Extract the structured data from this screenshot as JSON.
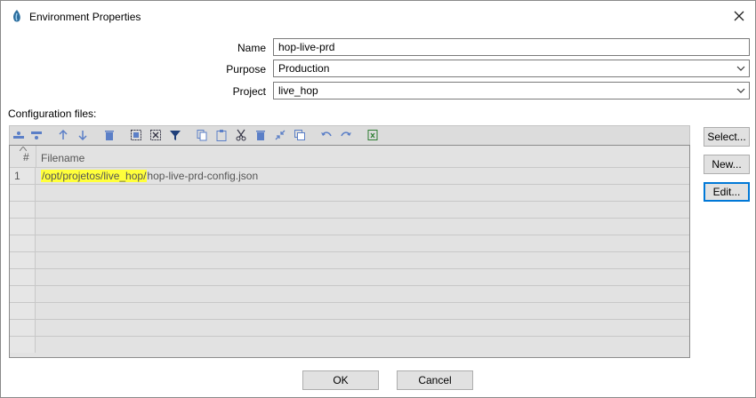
{
  "window": {
    "title": "Environment Properties"
  },
  "form": {
    "name_label": "Name",
    "name_value": "hop-live-prd",
    "purpose_label": "Purpose",
    "purpose_value": "Production",
    "project_label": "Project",
    "project_value": "live_hop"
  },
  "config": {
    "label": "Configuration files:",
    "table": {
      "col_num": "#",
      "col_filename": "Filename",
      "rows": [
        {
          "num": "1",
          "path_highlight": "/opt/projetos/live_hop/",
          "path_rest": "hop-live-prd-config.json"
        }
      ]
    }
  },
  "side_buttons": {
    "select": "Select...",
    "new": "New...",
    "edit": "Edit..."
  },
  "buttons": {
    "ok": "OK",
    "cancel": "Cancel"
  },
  "colors": {
    "highlight": "#ffff3b",
    "toolbar_icon": "#5b7fc7",
    "focus_border": "#0078d7"
  }
}
